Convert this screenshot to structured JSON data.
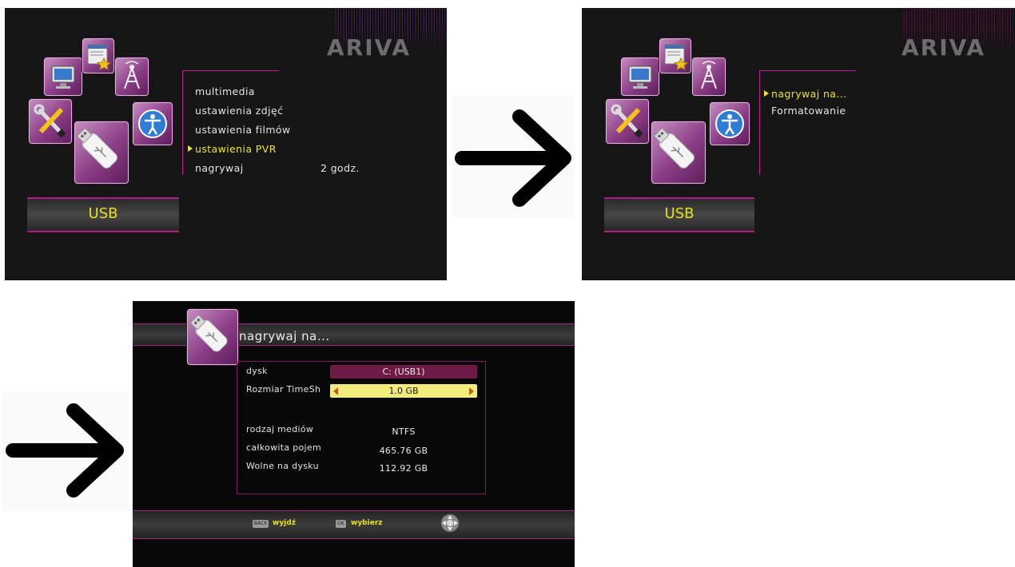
{
  "brand": {
    "logo": "ARIVA"
  },
  "screen1": {
    "section_label": "USB",
    "menu": [
      {
        "label": "multimedia",
        "value": "",
        "selected": false
      },
      {
        "label": "ustawienia zdjęć",
        "value": "",
        "selected": false
      },
      {
        "label": "ustawienia filmów",
        "value": "",
        "selected": false
      },
      {
        "label": "ustawienia PVR",
        "value": "",
        "selected": true
      },
      {
        "label": "nagrywaj",
        "value": "2 godz.",
        "selected": false
      }
    ]
  },
  "screen2": {
    "section_label": "USB",
    "menu": [
      {
        "label": "nagrywaj na...",
        "selected": true
      },
      {
        "label": "Formatowanie",
        "selected": false
      }
    ]
  },
  "screen3": {
    "title": "nagrywaj na...",
    "fields": {
      "disk_label": "dysk",
      "disk_value": "C: (USB1)",
      "timeshift_label": "Rozmiar TimeSh",
      "timeshift_value": "1.0 GB",
      "media_label": "rodzaj mediów",
      "media_value": "NTFS",
      "total_label": "całkowita pojem",
      "total_value": "465.76 GB",
      "free_label": "Wolne na dysku",
      "free_value": "112.92 GB"
    },
    "footer": {
      "back_key": "BACK",
      "back_label": "wyjdź",
      "ok_key": "OK",
      "ok_label": "wybierz"
    }
  },
  "icons": [
    "monitor-icon",
    "settings-window-icon",
    "antenna-icon",
    "tools-icon",
    "accessibility-icon",
    "usb-drive-icon",
    "arrow-right-icon",
    "navigation-pad-icon"
  ],
  "colors": {
    "accent": "#c01c8f",
    "highlight": "#ece41d",
    "screen_bg": "#151515",
    "tile_purple": "#8b3d86"
  }
}
